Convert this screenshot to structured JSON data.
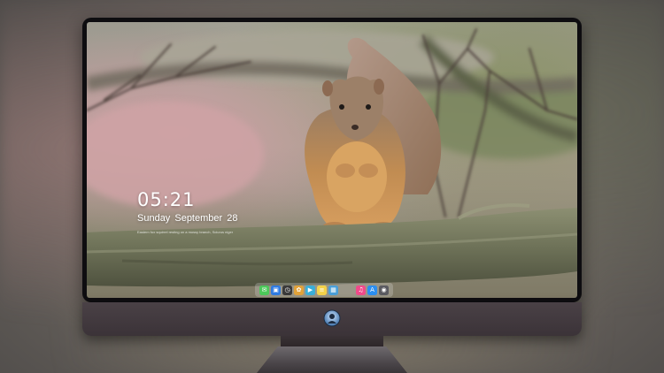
{
  "lock_screen": {
    "time": "05:21",
    "date": "Sunday September  28",
    "caption": "Eastern fox squirrel resting on a mossy branch, Sciurus niger"
  },
  "dock": {
    "apps": [
      {
        "name": "messages-icon",
        "glyph": "✉",
        "color": "#4cc85a"
      },
      {
        "name": "finder-icon",
        "glyph": "▣",
        "color": "#2f7be0"
      },
      {
        "name": "clock-icon",
        "glyph": "◷",
        "color": "#3a3a3a"
      },
      {
        "name": "photos-icon",
        "glyph": "✿",
        "color": "#e0a23a"
      },
      {
        "name": "video-icon",
        "glyph": "▶",
        "color": "#3aaed8"
      },
      {
        "name": "notes-icon",
        "glyph": "≡",
        "color": "#f3d24a"
      },
      {
        "name": "preview-icon",
        "glyph": "▦",
        "color": "#4a9fd8"
      },
      {
        "name": "music-icon",
        "glyph": "♫",
        "color": "#f04a8a"
      },
      {
        "name": "app-store-icon",
        "glyph": "A",
        "color": "#2b8ef0"
      },
      {
        "name": "camera-icon",
        "glyph": "◉",
        "color": "#5a5a60"
      }
    ]
  },
  "colors": {
    "screen_bezel": "#0e0d10",
    "chin": "#3b3338",
    "clock_text": "#ffffff"
  }
}
